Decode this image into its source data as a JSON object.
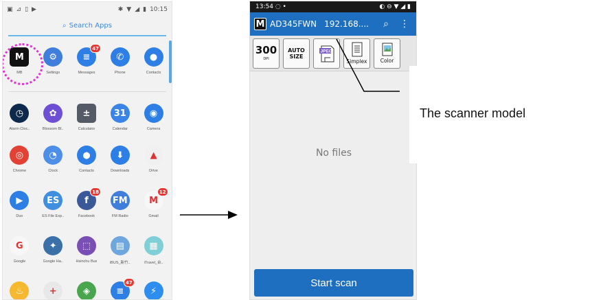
{
  "drawer": {
    "status_time": "10:15",
    "search_label": "Search Apps",
    "rows": [
      [
        {
          "label": "MB",
          "icon": "mb-logo-icon",
          "color": "#111111",
          "glyph": "M",
          "badge": ""
        },
        {
          "label": "Settings",
          "icon": "settings-gear-icon",
          "color": "#3f7fdb",
          "glyph": "⚙",
          "badge": ""
        },
        {
          "label": "Messages",
          "icon": "messages-icon",
          "color": "#2d7fe6",
          "glyph": "≡",
          "badge": "47"
        },
        {
          "label": "Phone",
          "icon": "phone-icon",
          "color": "#2d7fe6",
          "glyph": "✆",
          "badge": ""
        },
        {
          "label": "Contacts",
          "icon": "contacts-icon",
          "color": "#2d7fe6",
          "glyph": "●",
          "badge": ""
        }
      ],
      [
        {
          "label": "Alarm Cloc..",
          "icon": "alarm-clock-icon",
          "color": "#0d2a4d",
          "glyph": "◷",
          "badge": ""
        },
        {
          "label": "Blossom Bl..",
          "icon": "blossom-blast-icon",
          "color": "#6d4fd6",
          "glyph": "✿",
          "badge": ""
        },
        {
          "label": "Calculator",
          "icon": "calculator-icon",
          "color": "#555b66",
          "glyph": "±",
          "badge": ""
        },
        {
          "label": "Calendar",
          "icon": "calendar-icon",
          "color": "#3a84e8",
          "glyph": "31",
          "badge": ""
        },
        {
          "label": "Camera",
          "icon": "camera-icon",
          "color": "#2d7fe6",
          "glyph": "◉",
          "badge": ""
        }
      ],
      [
        {
          "label": "Chrome",
          "icon": "chrome-icon",
          "color": "#e34133",
          "glyph": "◎",
          "badge": ""
        },
        {
          "label": "Clock",
          "icon": "clock-icon",
          "color": "#4d8ee8",
          "glyph": "◔",
          "badge": ""
        },
        {
          "label": "Contacts",
          "icon": "contacts-icon",
          "color": "#2d7fe6",
          "glyph": "●",
          "badge": ""
        },
        {
          "label": "Downloads",
          "icon": "downloads-icon",
          "color": "#2d7fe6",
          "glyph": "⬇",
          "badge": ""
        },
        {
          "label": "Drive",
          "icon": "drive-icon",
          "color": "#f0f0f0",
          "glyph": "▲",
          "badge": ""
        }
      ],
      [
        {
          "label": "Duo",
          "icon": "duo-icon",
          "color": "#2d7fe6",
          "glyph": "▶",
          "badge": ""
        },
        {
          "label": "ES File Exp..",
          "icon": "es-file-explorer-icon",
          "color": "#3f8ee0",
          "glyph": "ES",
          "badge": ""
        },
        {
          "label": "Facebook",
          "icon": "facebook-icon",
          "color": "#3b5998",
          "glyph": "f",
          "badge": "18"
        },
        {
          "label": "FM Radio",
          "icon": "fm-radio-icon",
          "color": "#3f7fdb",
          "glyph": "FM",
          "badge": ""
        },
        {
          "label": "Gmail",
          "icon": "gmail-icon",
          "color": "#f7f7f7",
          "glyph": "M",
          "badge": "12"
        }
      ],
      [
        {
          "label": "Google",
          "icon": "google-icon",
          "color": "#f7f7f7",
          "glyph": "G",
          "badge": ""
        },
        {
          "label": "Google Ha..",
          "icon": "google-hangouts-icon",
          "color": "#3a6fa8",
          "glyph": "✦",
          "badge": ""
        },
        {
          "label": "Hsinchu Bus",
          "icon": "hsinchu-bus-icon",
          "color": "#7a4fb5",
          "glyph": "⬚",
          "badge": ""
        },
        {
          "label": "iBUS_新竹..",
          "icon": "ibus-icon",
          "color": "#6fa6de",
          "glyph": "▤",
          "badge": ""
        },
        {
          "label": "iTravel_台..",
          "icon": "itravel-icon",
          "color": "#7fd0d6",
          "glyph": "▦",
          "badge": ""
        }
      ],
      [
        {
          "label": "",
          "icon": "lightbulb-icon",
          "color": "#f5b82e",
          "glyph": "♨",
          "badge": ""
        },
        {
          "label": "",
          "icon": "plus-icon",
          "color": "#e8e8e8",
          "glyph": "+",
          "badge": ""
        },
        {
          "label": "",
          "icon": "maps-icon",
          "color": "#4aa64e",
          "glyph": "◈",
          "badge": ""
        },
        {
          "label": "",
          "icon": "messages-icon",
          "color": "#2d7fe6",
          "glyph": "≡",
          "badge": "47"
        },
        {
          "label": "",
          "icon": "messenger-icon",
          "color": "#2d8ef0",
          "glyph": "⚡",
          "badge": ""
        }
      ]
    ]
  },
  "scanner": {
    "status_time": "13:54",
    "model": "AD345FWN",
    "ip": "192.168....",
    "resolution_value": "300",
    "resolution_unit": "DPI",
    "autosize_line1": "AUTO",
    "autosize_line2": "SIZE",
    "format_label": "JPEG",
    "simplex_label": "Simplex",
    "color_label": "Color",
    "empty_text": "No files",
    "start_label": "Start scan"
  },
  "annotation": {
    "text": "The scanner model"
  },
  "colors": {
    "accent_blue": "#1f6fc0",
    "highlight_magenta": "#e230d8"
  }
}
